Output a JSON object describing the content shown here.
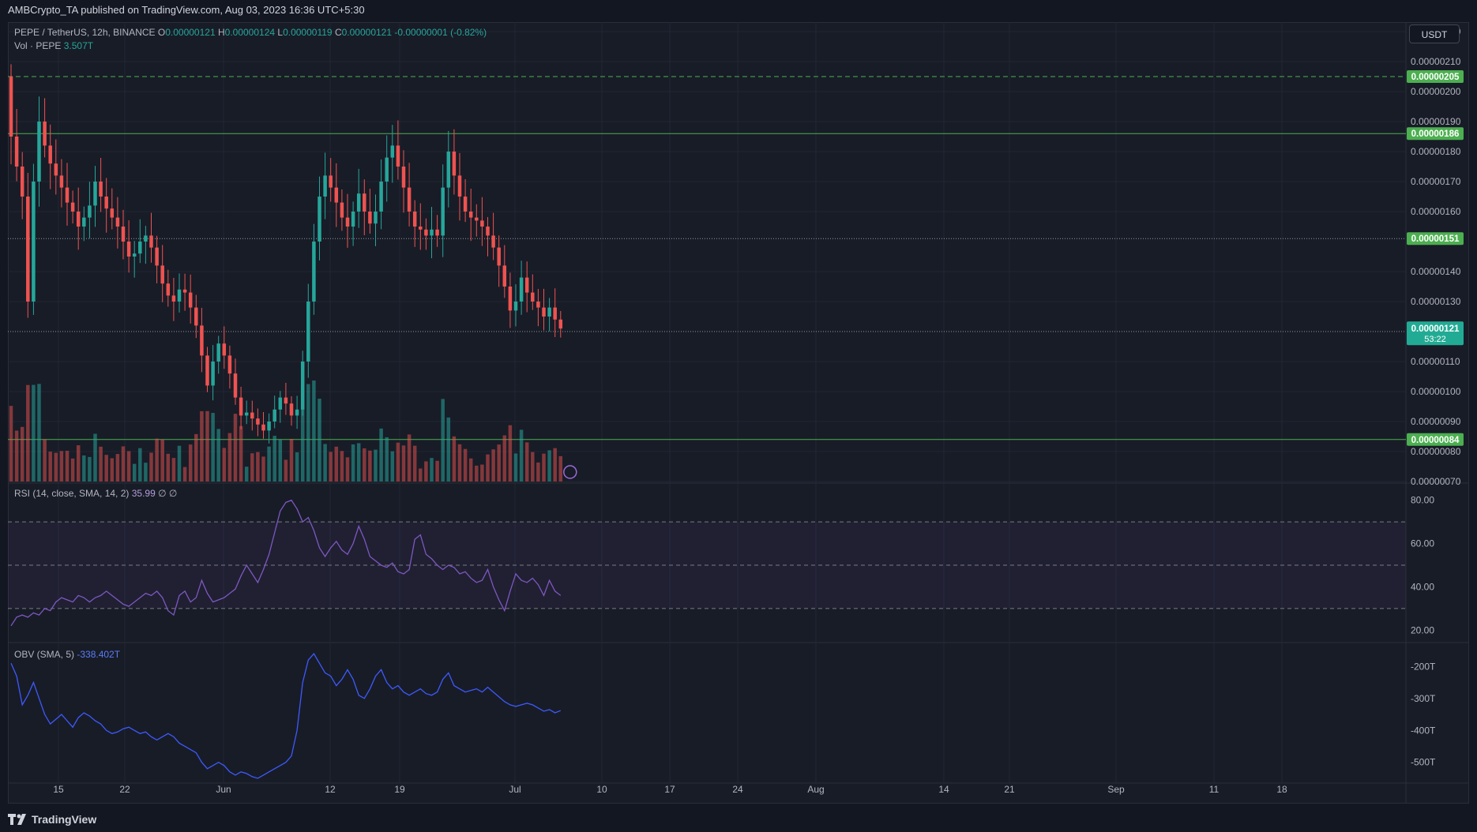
{
  "header": {
    "published": "AMBCrypto_TA published on TradingView.com, Aug 03, 2023 16:36 UTC+5:30"
  },
  "legend": {
    "symbol": "PEPE / TetherUS, 12h, BINANCE",
    "o_label": "O",
    "o": "0.00000121",
    "h_label": "H",
    "h": "0.00000124",
    "l_label": "L",
    "l": "0.00000119",
    "c_label": "C",
    "c": "0.00000121",
    "change": "-0.00000001 (-0.82%)",
    "vol_label": "Vol · PEPE",
    "vol": "3.507T",
    "rsi_label": "RSI (14, close, SMA, 14, 2)",
    "rsi_value": "35.99",
    "rsi_extra": "∅ ∅",
    "obv_label": "OBV (SMA, 5)",
    "obv_value": "-338.402T"
  },
  "currency_button": "USDT",
  "countdown": "53:22",
  "footer": {
    "brand": "TradingView"
  },
  "colors": {
    "up": "#26a69a",
    "down": "#ef5350",
    "level": "#4caf50",
    "rsi": "#7e57c2",
    "obv": "#3d5afe",
    "background": "#181c27"
  },
  "chart_data": [
    {
      "type": "candlestick",
      "title": "PEPE / TetherUS, 12h, BINANCE",
      "x_ticks": [
        "15",
        "22",
        "Jun",
        "12",
        "19",
        "Jul",
        "10",
        "17",
        "24",
        "Aug",
        "14",
        "21",
        "Sep",
        "11",
        "18"
      ],
      "y_ticks": [
        "0.00000220",
        "0.00000210",
        "0.00000200",
        "0.00000190",
        "0.00000180",
        "0.00000170",
        "0.00000160",
        "0.00000140",
        "0.00000130",
        "0.00000110",
        "0.00000100",
        "0.00000090",
        "0.00000080",
        "0.00000070"
      ],
      "ylim": [
        7e-07,
        2.2e-06
      ],
      "levels": [
        {
          "value": 2.05e-06,
          "label": "0.00000205",
          "style": "dashed"
        },
        {
          "value": 1.86e-06,
          "label": "0.00000186",
          "style": "solid"
        },
        {
          "value": 1.51e-06,
          "label": "0.00000151",
          "style": "dotted"
        },
        {
          "value": 1.2e-06,
          "label": "0.00000120",
          "style": "dotted"
        },
        {
          "value": 8.4e-07,
          "label": "0.00000084",
          "style": "solid"
        }
      ],
      "last_price": {
        "value": 1.21e-06,
        "label": "0.00000121"
      },
      "close_series": [
        1.85e-06,
        1.75e-06,
        1.65e-06,
        1.3e-06,
        1.7e-06,
        1.9e-06,
        1.82e-06,
        1.76e-06,
        1.72e-06,
        1.68e-06,
        1.63e-06,
        1.6e-06,
        1.55e-06,
        1.58e-06,
        1.62e-06,
        1.7e-06,
        1.65e-06,
        1.61e-06,
        1.58e-06,
        1.55e-06,
        1.5e-06,
        1.45e-06,
        1.46e-06,
        1.5e-06,
        1.52e-06,
        1.48e-06,
        1.42e-06,
        1.36e-06,
        1.32e-06,
        1.3e-06,
        1.34e-06,
        1.33e-06,
        1.28e-06,
        1.22e-06,
        1.12e-06,
        1.02e-06,
        1.1e-06,
        1.16e-06,
        1.12e-06,
        1.06e-06,
        9.8e-07,
        9.2e-07,
        9.3e-07,
        9.1e-07,
        8.9e-07,
        8.7e-07,
        9e-07,
        9.4e-07,
        9.8e-07,
        9.6e-07,
        9.2e-07,
        9.4e-07,
        1.1e-06,
        1.3e-06,
        1.5e-06,
        1.65e-06,
        1.72e-06,
        1.68e-06,
        1.63e-06,
        1.58e-06,
        1.55e-06,
        1.6e-06,
        1.66e-06,
        1.6e-06,
        1.56e-06,
        1.6e-06,
        1.7e-06,
        1.78e-06,
        1.82e-06,
        1.75e-06,
        1.68e-06,
        1.6e-06,
        1.55e-06,
        1.54e-06,
        1.52e-06,
        1.54e-06,
        1.52e-06,
        1.68e-06,
        1.8e-06,
        1.72e-06,
        1.65e-06,
        1.6e-06,
        1.58e-06,
        1.57e-06,
        1.55e-06,
        1.52e-06,
        1.48e-06,
        1.42e-06,
        1.35e-06,
        1.27e-06,
        1.3e-06,
        1.38e-06,
        1.33e-06,
        1.3e-06,
        1.28e-06,
        1.25e-06,
        1.28e-06,
        1.24e-06,
        1.21e-06
      ],
      "volume_axis": {
        "series": "Vol · PEPE",
        "last": "3.507T"
      }
    },
    {
      "type": "line",
      "name": "RSI (14, close, SMA, 14, 2)",
      "last_value": 35.99,
      "y_ticks": [
        "80.00",
        "60.00",
        "40.00",
        "20.00"
      ],
      "ylim": [
        15,
        85
      ],
      "band": [
        30,
        70
      ],
      "midline": 50,
      "values": [
        22,
        26,
        27,
        26,
        28,
        27,
        30,
        29,
        33,
        35,
        34,
        33,
        36,
        35,
        33,
        35,
        36,
        38,
        36,
        34,
        32,
        31,
        33,
        35,
        37,
        36,
        38,
        35,
        29,
        27,
        36,
        38,
        33,
        35,
        43,
        37,
        33,
        34,
        35,
        37,
        39,
        45,
        50,
        46,
        42,
        48,
        55,
        65,
        75,
        79,
        80,
        76,
        70,
        72,
        66,
        58,
        54,
        58,
        61,
        57,
        55,
        60,
        68,
        62,
        54,
        52,
        50,
        49,
        51,
        47,
        46,
        48,
        62,
        64,
        55,
        53,
        50,
        48,
        50,
        49,
        46,
        47,
        44,
        42,
        43,
        48,
        40,
        34,
        29,
        38,
        46,
        43,
        42,
        44,
        41,
        36,
        43,
        38,
        36
      ]
    },
    {
      "type": "line",
      "name": "OBV (SMA, 5)",
      "last_value": "-338.402T",
      "y_ticks": [
        "-200T",
        "-300T",
        "-400T",
        "-500T"
      ],
      "ylim": [
        -560,
        -130
      ],
      "values": [
        -190,
        -230,
        -320,
        -290,
        -250,
        -300,
        -350,
        -380,
        -365,
        -350,
        -370,
        -390,
        -360,
        -345,
        -355,
        -370,
        -380,
        -400,
        -410,
        -405,
        -395,
        -390,
        -400,
        -410,
        -405,
        -420,
        -430,
        -420,
        -410,
        -420,
        -440,
        -450,
        -460,
        -470,
        -500,
        -520,
        -510,
        -500,
        -510,
        -530,
        -540,
        -530,
        -535,
        -545,
        -550,
        -540,
        -530,
        -520,
        -510,
        -500,
        -480,
        -400,
        -250,
        -180,
        -160,
        -190,
        -220,
        -230,
        -260,
        -240,
        -210,
        -240,
        -290,
        -300,
        -270,
        -230,
        -210,
        -250,
        -270,
        -260,
        -280,
        -290,
        -280,
        -270,
        -285,
        -290,
        -280,
        -240,
        -220,
        -260,
        -270,
        -280,
        -275,
        -270,
        -280,
        -265,
        -280,
        -295,
        -310,
        -320,
        -325,
        -320,
        -315,
        -320,
        -330,
        -340,
        -335,
        -345,
        -338
      ]
    }
  ]
}
